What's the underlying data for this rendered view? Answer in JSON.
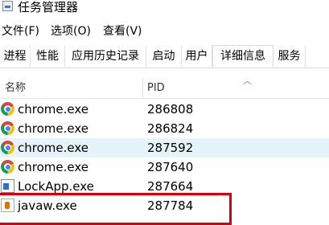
{
  "window": {
    "title": "任务管理器"
  },
  "menu": [
    "文件(F)",
    "选项(O)",
    "查看(V)"
  ],
  "tabs": [
    "进程",
    "性能",
    "应用历史记录",
    "启动",
    "用户",
    "详细信息",
    "服务"
  ],
  "active_tab": "详细信息",
  "columns": {
    "name": "名称",
    "pid": "PID"
  },
  "rows": [
    {
      "name": "chrome.exe",
      "pid": "286808",
      "icon": "chrome-icon"
    },
    {
      "name": "chrome.exe",
      "pid": "286824",
      "icon": "chrome-icon"
    },
    {
      "name": "chrome.exe",
      "pid": "287592",
      "icon": "chrome-icon",
      "selected": true
    },
    {
      "name": "chrome.exe",
      "pid": "287640",
      "icon": "chrome-icon"
    },
    {
      "name": "LockApp.exe",
      "pid": "287664",
      "icon": "lockapp-icon"
    },
    {
      "name": "javaw.exe",
      "pid": "287784",
      "icon": "java-icon"
    }
  ],
  "colors": {
    "selection": "#e5f3fb",
    "highlight_box": "#d4000c"
  }
}
